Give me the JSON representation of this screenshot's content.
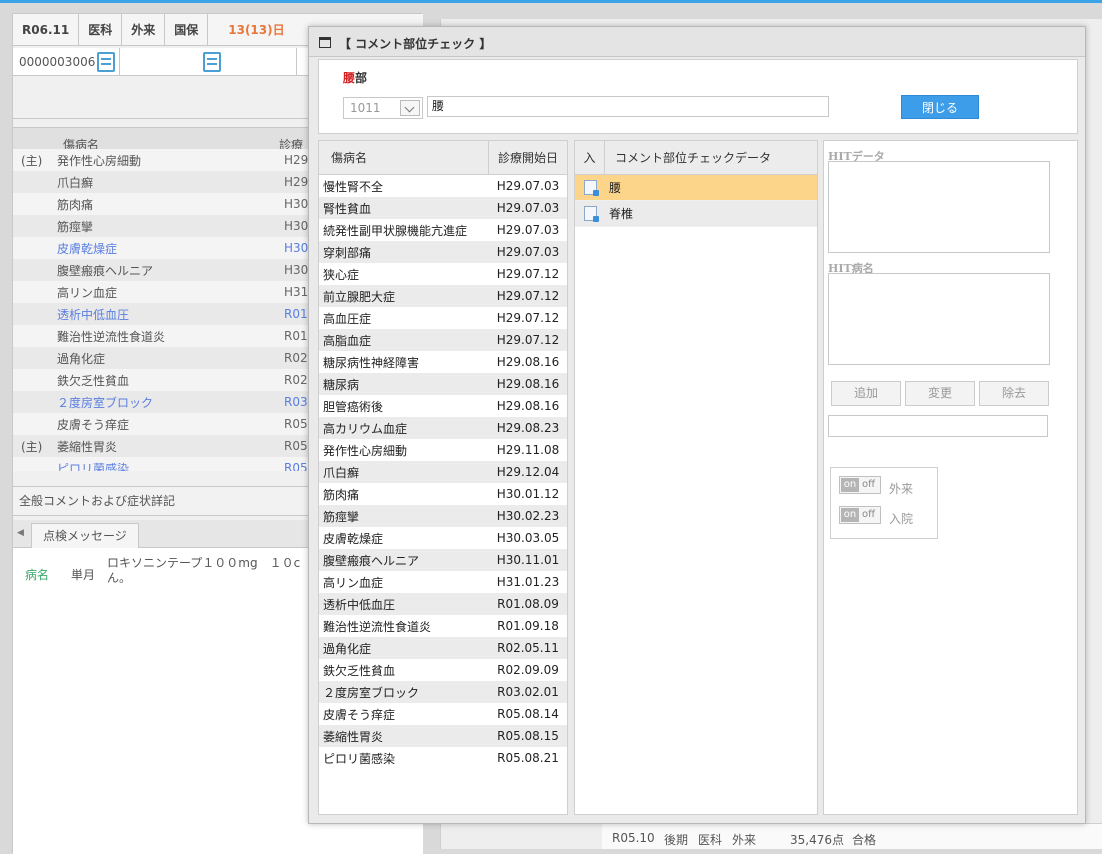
{
  "patient_header": {
    "date": "R06.11",
    "dept": "医科",
    "visit": "外来",
    "insurance": "国保",
    "days": "13(13)日",
    "patient_id": "0000003006"
  },
  "disease_header": {
    "name_col": "傷病名",
    "date_col": "診療"
  },
  "disease_list": [
    {
      "mark": "(主)",
      "name": "発作性心房細動",
      "date": "H29",
      "blue": false
    },
    {
      "mark": "",
      "name": "爪白癬",
      "date": "H29",
      "blue": false
    },
    {
      "mark": "",
      "name": "筋肉痛",
      "date": "H30",
      "blue": false
    },
    {
      "mark": "",
      "name": "筋痙攣",
      "date": "H30",
      "blue": false
    },
    {
      "mark": "",
      "name": "皮膚乾燥症",
      "date": "H30",
      "blue": true
    },
    {
      "mark": "",
      "name": "腹壁瘢痕ヘルニア",
      "date": "H30",
      "blue": false
    },
    {
      "mark": "",
      "name": "高リン血症",
      "date": "H31",
      "blue": false
    },
    {
      "mark": "",
      "name": "透析中低血圧",
      "date": "R01",
      "blue": true
    },
    {
      "mark": "",
      "name": "難治性逆流性食道炎",
      "date": "R01",
      "blue": false
    },
    {
      "mark": "",
      "name": "過角化症",
      "date": "R02",
      "blue": false
    },
    {
      "mark": "",
      "name": "鉄欠乏性貧血",
      "date": "R02",
      "blue": false
    },
    {
      "mark": "",
      "name": "２度房室ブロック",
      "date": "R03",
      "blue": true
    },
    {
      "mark": "",
      "name": "皮膚そう痒症",
      "date": "R05",
      "blue": false
    },
    {
      "mark": "(主)",
      "name": "萎縮性胃炎",
      "date": "R05",
      "blue": false
    },
    {
      "mark": "",
      "name": "ピロリ菌感染",
      "date": "R05",
      "blue": true
    }
  ],
  "general_comment_label": "全般コメントおよび症状詳記",
  "check_tab_label": "点検メッセージ",
  "message": {
    "type": "病名",
    "period": "単月",
    "text": "ロキソニンテープ１００mg　１０c\nん。"
  },
  "bottom_row": {
    "ym": "R05.10",
    "half": "後期",
    "dept": "医科",
    "visit": "外来",
    "points": "35,476点",
    "result": "合格"
  },
  "modal": {
    "title": "【 コメント部位チェック 】",
    "part_label_red": "腰",
    "part_label_rest": "部",
    "code_value": "1011",
    "part_input": "腰",
    "close_button": "閉じる",
    "table1_headers": [
      "傷病名",
      "診療開始日"
    ],
    "table1_rows": [
      [
        "慢性腎不全",
        "H29.07.03"
      ],
      [
        "腎性貧血",
        "H29.07.03"
      ],
      [
        "続発性副甲状腺機能亢進症",
        "H29.07.03"
      ],
      [
        "穿刺部痛",
        "H29.07.03"
      ],
      [
        "狭心症",
        "H29.07.12"
      ],
      [
        "前立腺肥大症",
        "H29.07.12"
      ],
      [
        "高血圧症",
        "H29.07.12"
      ],
      [
        "高脂血症",
        "H29.07.12"
      ],
      [
        "糖尿病性神経障害",
        "H29.08.16"
      ],
      [
        "糖尿病",
        "H29.08.16"
      ],
      [
        "胆管癌術後",
        "H29.08.16"
      ],
      [
        "高カリウム血症",
        "H29.08.23"
      ],
      [
        "発作性心房細動",
        "H29.11.08"
      ],
      [
        "爪白癬",
        "H29.12.04"
      ],
      [
        "筋肉痛",
        "H30.01.12"
      ],
      [
        "筋痙攣",
        "H30.02.23"
      ],
      [
        "皮膚乾燥症",
        "H30.03.05"
      ],
      [
        "腹壁瘢痕ヘルニア",
        "H30.11.01"
      ],
      [
        "高リン血症",
        "H31.01.23"
      ],
      [
        "透析中低血圧",
        "R01.08.09"
      ],
      [
        "難治性逆流性食道炎",
        "R01.09.18"
      ],
      [
        "過角化症",
        "R02.05.11"
      ],
      [
        "鉄欠乏性貧血",
        "R02.09.09"
      ],
      [
        "２度房室ブロック",
        "R03.02.01"
      ],
      [
        "皮膚そう痒症",
        "R05.08.14"
      ],
      [
        "萎縮性胃炎",
        "R05.08.15"
      ],
      [
        "ピロリ菌感染",
        "R05.08.21"
      ]
    ],
    "table2_headers": [
      "入",
      "コメント部位チェックデータ"
    ],
    "table2_rows": [
      "腰",
      "脊椎"
    ],
    "hit_data_label": "HITデータ",
    "hit_disease_label": "HIT病名",
    "buttons": [
      "追加",
      "変更",
      "除去"
    ],
    "toggle_on": "on",
    "toggle_off": "off",
    "toggles": [
      "外来",
      "入院"
    ]
  },
  "colors": {
    "accent_blue": "#3d9de8",
    "selected_row": "#fdd58a",
    "required_red": "#d42020",
    "days_orange": "#e8773c"
  }
}
